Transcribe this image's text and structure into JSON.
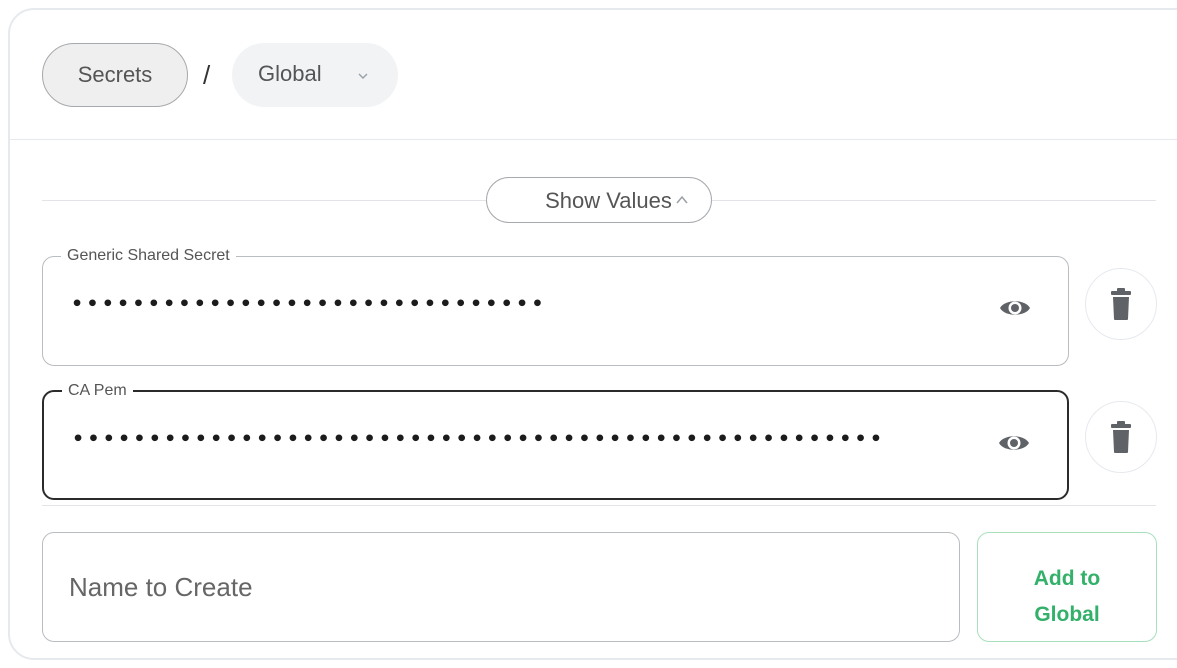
{
  "breadcrumb": {
    "root_label": "Secrets",
    "separator": "/",
    "current_label": "Global"
  },
  "toggle": {
    "show_values_label": "Show Values"
  },
  "secrets": [
    {
      "name": "Generic Shared Secret",
      "masked_value": "•••••••••••••••••••••••••••••••",
      "focused": false
    },
    {
      "name": "CA Pem",
      "masked_value": "•••••••••••••••••••••••••••••••••••••••••••••••••••••",
      "focused": true
    }
  ],
  "create": {
    "placeholder": "Name to Create",
    "button_line1": "Add to",
    "button_line2": "Global"
  },
  "colors": {
    "accent_green": "#33b06a",
    "border": "#b9bcc0",
    "muted_bg": "#f1f3f5"
  }
}
